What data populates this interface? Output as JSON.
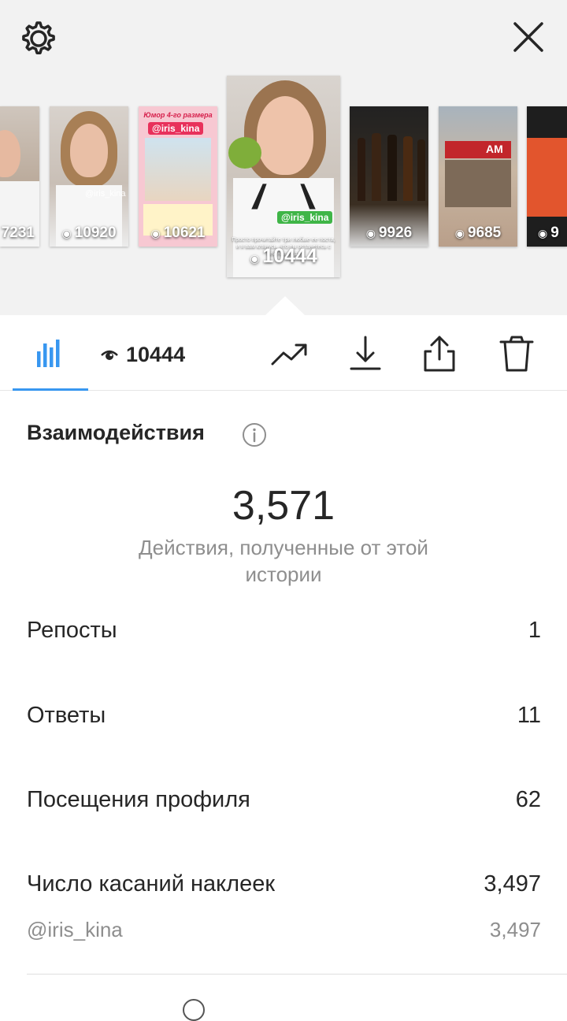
{
  "header": {
    "settings_icon": "gear-icon",
    "close_icon": "close-x-icon"
  },
  "stories": [
    {
      "views": "7231"
    },
    {
      "views": "10920",
      "tag": "@iris_kina"
    },
    {
      "views": "10621",
      "title": "Юмор 4-го размера",
      "tag": "@iris_kina"
    },
    {
      "views": "10444",
      "tag": "@iris_kina",
      "caption": "Просто прочитайте три любые ее поста, и я вам клянусь, что вы останетесь с ней навсегда"
    },
    {
      "views": "9926"
    },
    {
      "views": "9685",
      "sign": "AM"
    },
    {
      "views": "9"
    }
  ],
  "toolbar": {
    "view_count": "10444",
    "stats_icon": "bar-chart-icon",
    "eye_icon": "eye-icon",
    "trend_icon": "trend-up-icon",
    "download_icon": "download-icon",
    "share_icon": "share-icon",
    "delete_icon": "trash-icon",
    "accent_color": "#3897f0"
  },
  "interactions": {
    "title": "Взаимодействия",
    "info_icon": "info-icon",
    "total": "3,571",
    "total_caption": "Действия, полученные от этой истории",
    "rows": [
      {
        "label": "Репосты",
        "value": "1"
      },
      {
        "label": "Ответы",
        "value": "11"
      },
      {
        "label": "Посещения профиля",
        "value": "62"
      },
      {
        "label": "Число касаний наклеек",
        "value": "3,497"
      }
    ],
    "sub_rows": [
      {
        "label": "@iris_kina",
        "value": "3,497"
      }
    ]
  }
}
